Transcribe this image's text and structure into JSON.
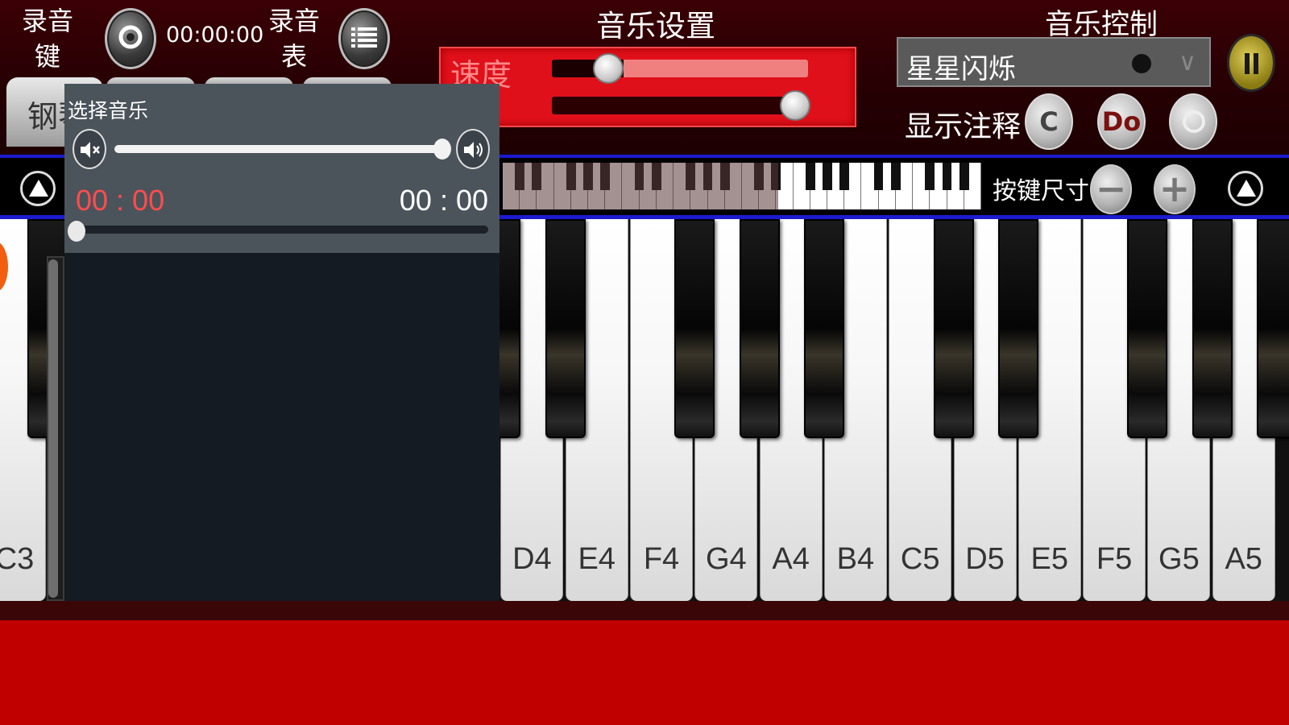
{
  "colors": {
    "accent_red": "#e0101a",
    "strip_blue": "#1b1bd0",
    "time_red": "#ff4d4d",
    "bottom_red": "#c00000"
  },
  "recording": {
    "record_key_label": "录音\n键",
    "record_icon": "record-icon",
    "timer": "00:00:00",
    "record_list_label": "录音\n表",
    "list_icon": "list-icon"
  },
  "mode_tabs": {
    "piano_label": "钢琴"
  },
  "music_settings": {
    "title": "音乐设置",
    "speed_label": "速度",
    "speed_level": 0.22,
    "volume_level": 0.95
  },
  "music_control": {
    "title": "音乐控制",
    "selected_song": "星星闪烁",
    "dropdown_icon": "chevron-down-icon",
    "pause_icon": "pause-icon",
    "show_notes_label": "显示注释",
    "note_buttons": [
      "C",
      "Do",
      ""
    ]
  },
  "keyboard_strip": {
    "key_size_label": "按键尺寸",
    "minus_label": "−",
    "plus_label": "+"
  },
  "piano": {
    "white_keys": [
      "C3",
      "",
      "",
      "",
      "",
      "",
      "",
      "",
      "D4",
      "E4",
      "F4",
      "G4",
      "A4",
      "B4",
      "C5",
      "D5",
      "E5",
      "F5",
      "G5",
      "A5"
    ]
  },
  "music_picker": {
    "title": "选择音乐",
    "volume_level": 1.0,
    "current_time": "00 : 00",
    "total_time": "00 : 00",
    "progress": 0.0
  }
}
